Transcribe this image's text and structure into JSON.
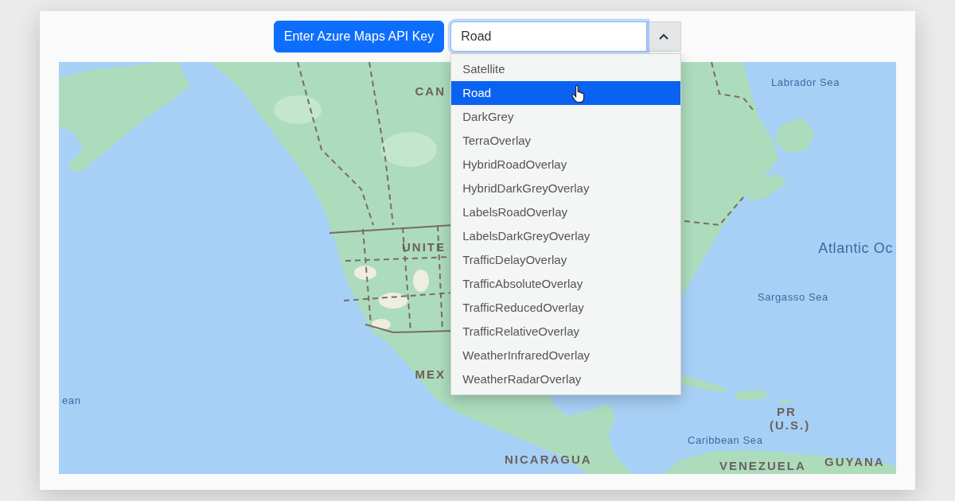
{
  "toolbar": {
    "api_key_button": {
      "label": "Enter Azure Maps API Key"
    }
  },
  "map_type_select": {
    "value": "Road",
    "expanded": true,
    "options": [
      {
        "label": "Satellite",
        "selected": false
      },
      {
        "label": "Road",
        "selected": true
      },
      {
        "label": "DarkGrey",
        "selected": false
      },
      {
        "label": "TerraOverlay",
        "selected": false
      },
      {
        "label": "HybridRoadOverlay",
        "selected": false
      },
      {
        "label": "HybridDarkGreyOverlay",
        "selected": false
      },
      {
        "label": "LabelsRoadOverlay",
        "selected": false
      },
      {
        "label": "LabelsDarkGreyOverlay",
        "selected": false
      },
      {
        "label": "TrafficDelayOverlay",
        "selected": false
      },
      {
        "label": "TrafficAbsoluteOverlay",
        "selected": false
      },
      {
        "label": "TrafficReducedOverlay",
        "selected": false
      },
      {
        "label": "TrafficRelativeOverlay",
        "selected": false
      },
      {
        "label": "WeatherInfraredOverlay",
        "selected": false
      },
      {
        "label": "WeatherRadarOverlay",
        "selected": false
      }
    ]
  },
  "map": {
    "labels": [
      {
        "text": "CAN",
        "kind": "place"
      },
      {
        "text": "UNITE",
        "kind": "place"
      },
      {
        "text": "MEX",
        "kind": "place"
      },
      {
        "text": "ean",
        "kind": "water"
      },
      {
        "text": "Labrador Sea",
        "kind": "water"
      },
      {
        "text": "Atlantic Oc",
        "kind": "water"
      },
      {
        "text": "Sargasso Sea",
        "kind": "water"
      },
      {
        "text": "PR",
        "kind": "place"
      },
      {
        "text": "(U.S.)",
        "kind": "place"
      },
      {
        "text": "Caribbean Sea",
        "kind": "water"
      },
      {
        "text": "NICARAGUA",
        "kind": "place"
      },
      {
        "text": "VENEZUELA",
        "kind": "place"
      },
      {
        "text": "GUYANA",
        "kind": "place"
      }
    ]
  }
}
